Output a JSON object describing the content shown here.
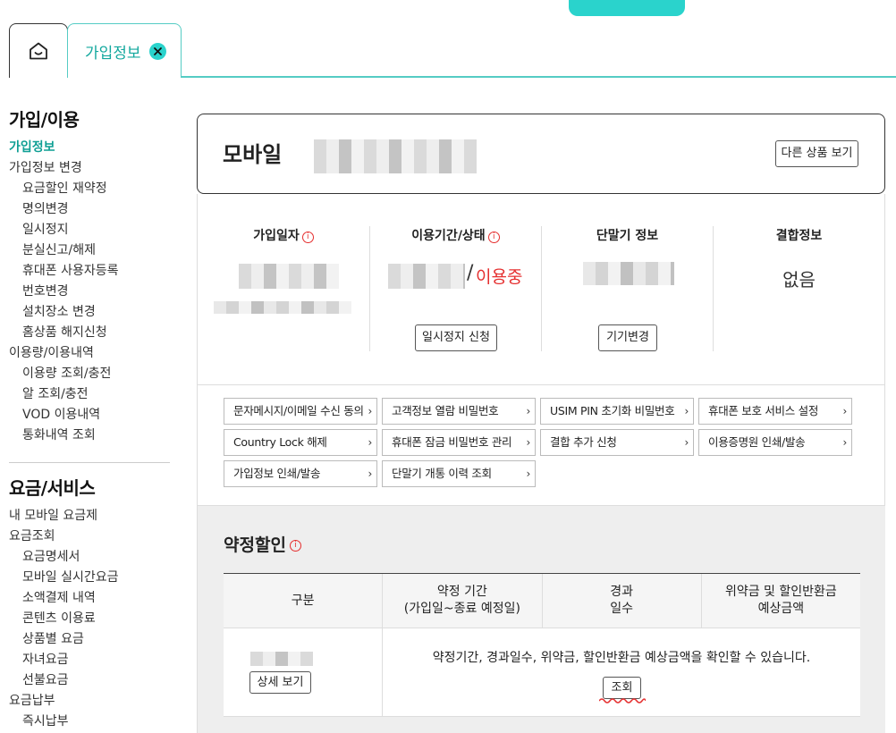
{
  "tabs": {
    "home_icon": "home-icon",
    "active_label": "가입정보",
    "close_icon": "close-icon"
  },
  "sidebar": {
    "groups": [
      {
        "heading": "가입/이용",
        "items": [
          {
            "label": "가입정보",
            "level": 0,
            "active": true
          },
          {
            "label": "가입정보 변경",
            "level": 0
          },
          {
            "label": "요금할인 재약정",
            "level": 1
          },
          {
            "label": "명의변경",
            "level": 1
          },
          {
            "label": "일시정지",
            "level": 1
          },
          {
            "label": "분실신고/해제",
            "level": 1
          },
          {
            "label": "휴대폰 사용자등록",
            "level": 1
          },
          {
            "label": "번호변경",
            "level": 1
          },
          {
            "label": "설치장소 변경",
            "level": 1
          },
          {
            "label": "홈상품 해지신청",
            "level": 1
          },
          {
            "label": "이용량/이용내역",
            "level": 0
          },
          {
            "label": "이용량 조회/충전",
            "level": 1
          },
          {
            "label": "알 조회/충전",
            "level": 1
          },
          {
            "label": "VOD 이용내역",
            "level": 1
          },
          {
            "label": "통화내역 조회",
            "level": 1
          }
        ]
      },
      {
        "heading": "요금/서비스",
        "items": [
          {
            "label": "내 모바일 요금제",
            "level": 0
          },
          {
            "label": "요금조회",
            "level": 0
          },
          {
            "label": "요금명세서",
            "level": 1
          },
          {
            "label": "모바일 실시간요금",
            "level": 1
          },
          {
            "label": "소액결제 내역",
            "level": 1
          },
          {
            "label": "콘텐츠 이용료",
            "level": 1
          },
          {
            "label": "상품별 요금",
            "level": 1
          },
          {
            "label": "자녀요금",
            "level": 1
          },
          {
            "label": "선불요금",
            "level": 1
          },
          {
            "label": "요금납부",
            "level": 0
          },
          {
            "label": "즉시납부",
            "level": 1
          }
        ]
      }
    ]
  },
  "product": {
    "title": "모바일",
    "other_button": "다른 상품 보기"
  },
  "info": {
    "join_date_label": "가입일자",
    "period_label": "이용기간/상태",
    "status_slash": "/",
    "status_value": "이용중",
    "suspend_button": "일시정지 신청",
    "device_label": "단말기 정보",
    "device_button": "기기변경",
    "bundle_label": "결합정보",
    "bundle_value": "없음",
    "info_icon": "info-icon"
  },
  "links": [
    "문자메시지/이메일 수신 동의",
    "고객정보 열람 비밀번호",
    "USIM PIN 초기화 비밀번호",
    "휴대폰 보호 서비스 설정",
    "Country Lock 해제",
    "휴대폰 잠금 비밀번호 관리",
    "결합 추가 신청",
    "이용증명원 인쇄/발송",
    "가입정보 인쇄/발송",
    "단말기 개통 이력 조회"
  ],
  "discount": {
    "title": "약정할인",
    "headers": [
      "구분",
      "약정 기간\n(가입일~종료 예정일)",
      "경과\n일수",
      "위약금 및 할인반환금\n예상금액"
    ],
    "detail_button": "상세 보기",
    "message": "약정기간, 경과일수, 위약금, 할인반환금 예상금액을 확인할 수 있습니다.",
    "lookup_button": "조회"
  },
  "colors": {
    "accent": "#2ad3cc",
    "accent_text": "#0f9f94",
    "alert": "#e53030"
  }
}
